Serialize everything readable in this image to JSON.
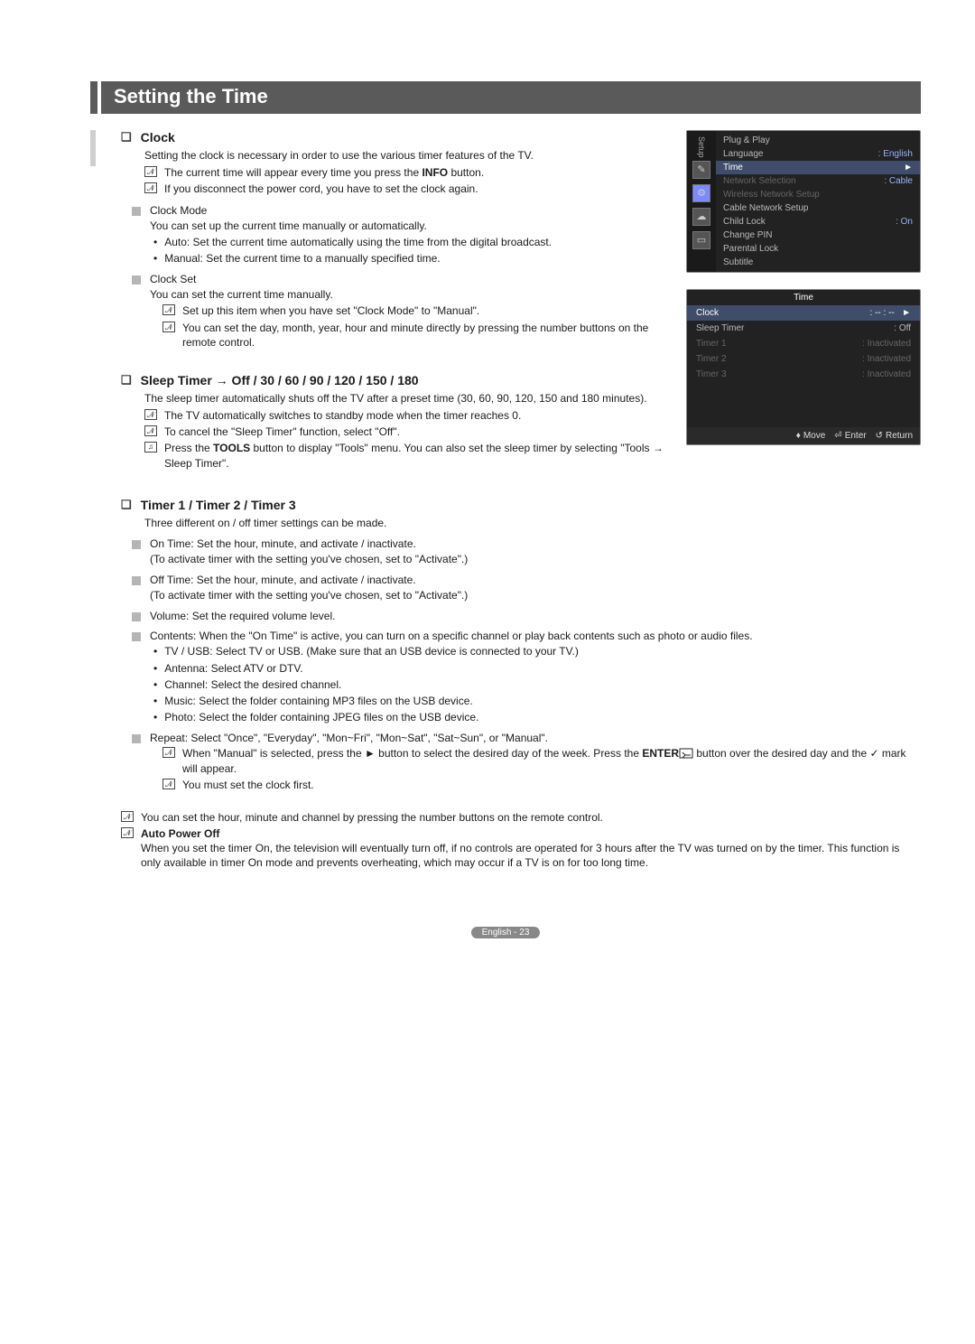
{
  "title": "Setting the Time",
  "clock": {
    "heading": "Clock",
    "intro": "Setting the clock is necessary in order to use the various timer features of the TV.",
    "note1_prefix": "The current time will appear every time you press the ",
    "note1_bold": "INFO",
    "note1_suffix": " button.",
    "note2": "If you disconnect the power cord, you have to set the clock again.",
    "mode_head": "Clock Mode",
    "mode_body": "You can set up the current time manually or automatically.",
    "mode_b1": "Auto: Set the current time automatically using the time from the digital broadcast.",
    "mode_b2": "Manual: Set the current time to a manually specified time.",
    "set_head": "Clock Set",
    "set_body": "You can set the current time manually.",
    "set_n1": "Set up this item when you have set \"Clock Mode\" to \"Manual\".",
    "set_n2": "You can set the day, month, year, hour and minute directly by pressing the number buttons on the remote control."
  },
  "sleep": {
    "heading": "Sleep Timer → Off / 30 / 60 / 90 / 120 / 150 / 180",
    "body": "The sleep timer automatically shuts off the TV after a preset time (30, 60, 90, 120, 150 and 180 minutes).",
    "n1": "The TV automatically switches to standby mode when the timer reaches 0.",
    "n2": "To cancel the \"Sleep Timer\" function, select \"Off\".",
    "tool_prefix": "Press the ",
    "tool_bold": "TOOLS",
    "tool_suffix": " button to display \"Tools\" menu. You can also set the sleep timer by selecting \"Tools → Sleep Timer\"."
  },
  "timer": {
    "heading": "Timer 1 / Timer 2 / Timer 3",
    "body": "Three different on / off timer settings can be made.",
    "ontime_a": "On Time: Set the hour, minute, and activate / inactivate.",
    "ontime_b": "(To activate timer with the setting you've chosen, set to \"Activate\".)",
    "offtime_a": "Off Time: Set the hour, minute, and activate / inactivate.",
    "offtime_b": "(To activate timer with the setting you've chosen, set to \"Activate\".)",
    "volume": "Volume: Set the required volume level.",
    "contents": "Contents: When the \"On Time\" is active, you can turn on a specific channel or play back contents such as photo or audio files.",
    "c1": "TV / USB: Select TV or USB. (Make sure that an USB device is connected to your TV.)",
    "c2": "Antenna: Select ATV or DTV.",
    "c3": "Channel: Select the desired channel.",
    "c4": "Music: Select the folder containing MP3 files on the USB device.",
    "c5": "Photo: Select the folder containing JPEG files on the USB device.",
    "repeat": "Repeat:  Select \"Once\", \"Everyday\", \"Mon~Fri\", \"Mon~Sat\", \"Sat~Sun\", or \"Manual\".",
    "rn1_a": "When \"Manual\" is selected, press the ► button to select the desired day of the week. Press the ",
    "rn1_bold": "ENTER",
    "rn1_b": " button over the desired day and the ✓ mark will appear.",
    "rn2": "You must set the clock first.",
    "bottom_note": "You can set the hour, minute and channel by pressing the number buttons on the remote control.",
    "apo_head": "Auto Power Off",
    "apo_body": "When you set the timer On, the television will eventually turn off, if no controls are operated for 3 hours after the TV was turned on by the timer. This function is only available in timer On mode and prevents overheating, which may occur if a TV is on for too long time."
  },
  "osd1": {
    "side_label": "Setup",
    "rows": [
      {
        "label": "Plug & Play",
        "val": "",
        "cls": ""
      },
      {
        "label": "Language",
        "val": ": English",
        "cls": ""
      },
      {
        "label": "Time",
        "val": "►",
        "cls": "hl"
      },
      {
        "label": "Network Selection",
        "val": ": Cable",
        "cls": "dim"
      },
      {
        "label": "Wireless Network Setup",
        "val": "",
        "cls": "dim"
      },
      {
        "label": "Cable Network Setup",
        "val": "",
        "cls": ""
      },
      {
        "label": "Child Lock",
        "val": ": On",
        "cls": ""
      },
      {
        "label": "Change PIN",
        "val": "",
        "cls": ""
      },
      {
        "label": "Parental Lock",
        "val": "",
        "cls": ""
      },
      {
        "label": "Subtitle",
        "val": "",
        "cls": ""
      }
    ]
  },
  "osd2": {
    "title": "Time",
    "rows": [
      {
        "label": "Clock",
        "val": ": -- : --",
        "arrow": "►",
        "cls": "hl"
      },
      {
        "label": "Sleep Timer",
        "val": ": Off",
        "arrow": "",
        "cls": ""
      },
      {
        "label": "Timer 1",
        "val": ": Inactivated",
        "arrow": "",
        "cls": "dim"
      },
      {
        "label": "Timer 2",
        "val": ": Inactivated",
        "arrow": "",
        "cls": "dim"
      },
      {
        "label": "Timer 3",
        "val": ": Inactivated",
        "arrow": "",
        "cls": "dim"
      }
    ],
    "footer": {
      "move": "Move",
      "enter": "Enter",
      "return": "Return"
    }
  },
  "footer": "English - 23"
}
